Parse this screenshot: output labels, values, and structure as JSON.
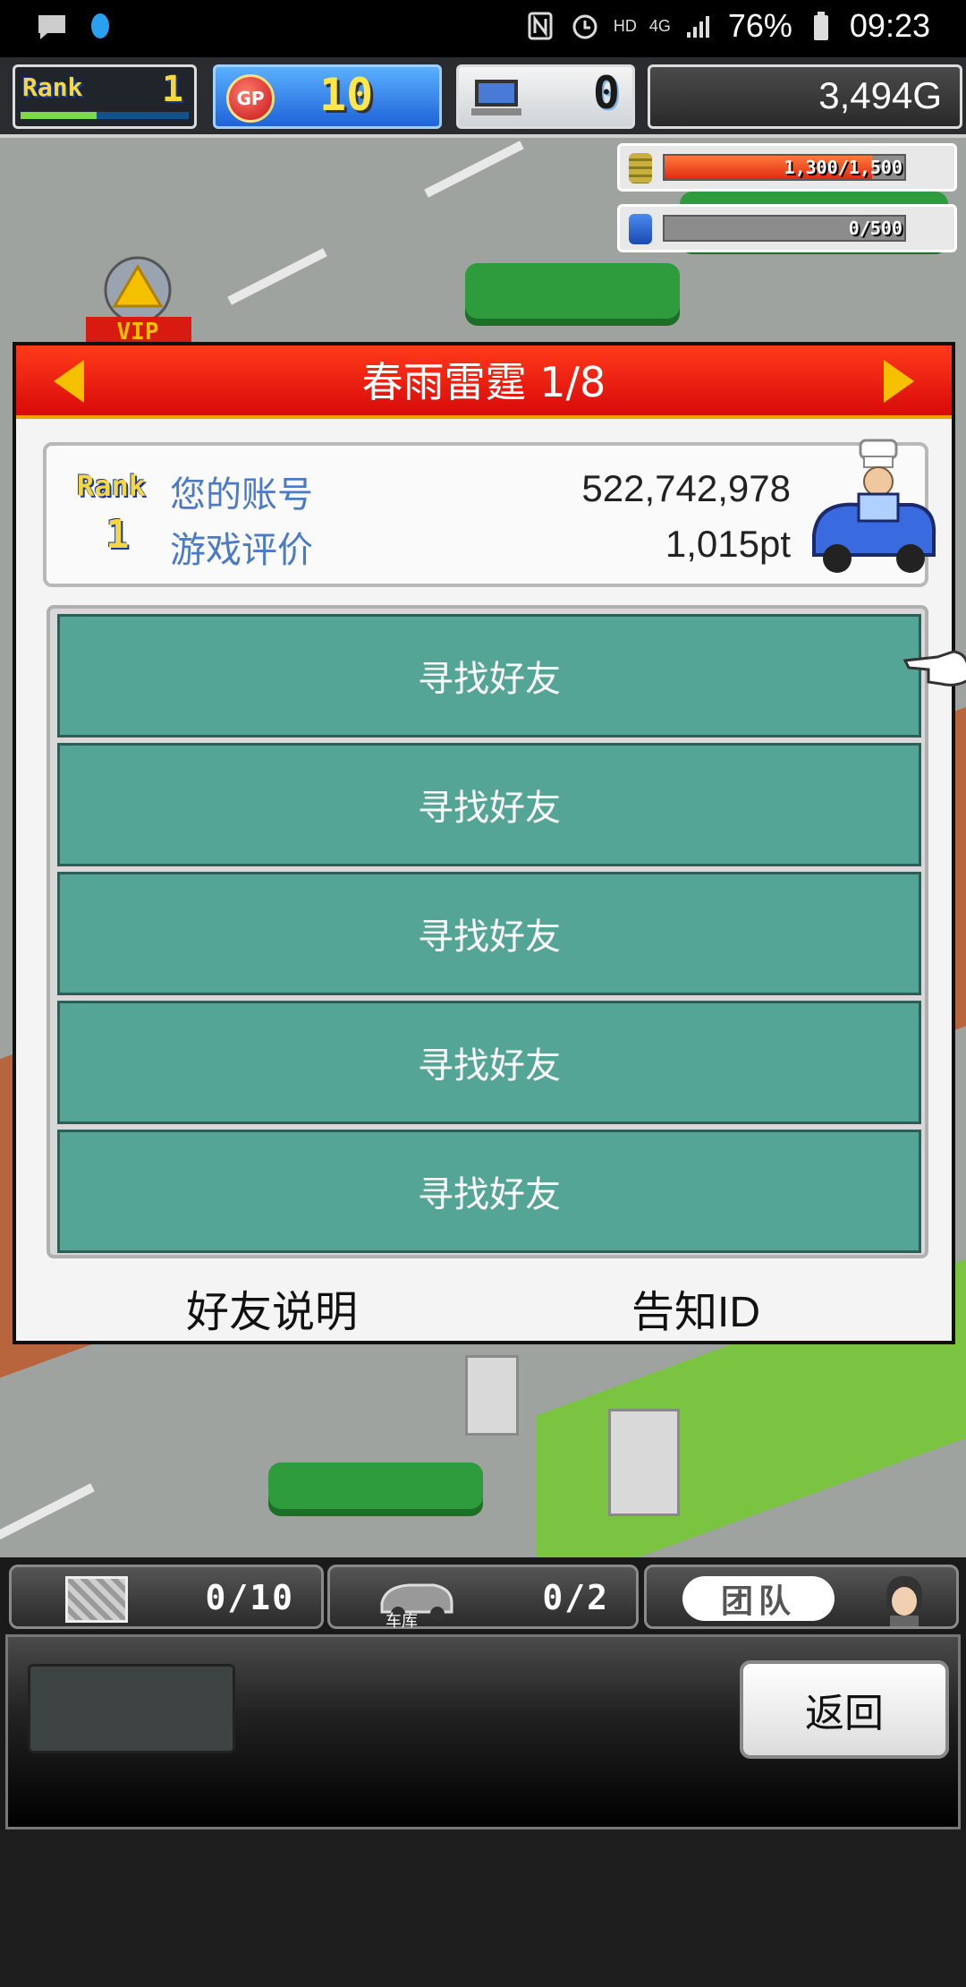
{
  "status_bar": {
    "network": "4G",
    "hd": "HD",
    "battery": "76%",
    "time": "09:23"
  },
  "hud": {
    "rank_word": "Rank",
    "rank_value": "1",
    "rank_progress": 0.45,
    "gp_label": "GP",
    "gp_value": "10",
    "pc_value": "0",
    "money": "3,494G"
  },
  "world": {
    "fuel_text": "1,300/1,500",
    "fuel_fraction": 0.867,
    "research_text": "0/500",
    "research_fraction": 0.0,
    "vip_text": "VIP"
  },
  "modal": {
    "title": "春雨雷霆 1/8",
    "profile": {
      "rank_word": "Rank",
      "rank_value": "1",
      "account_label": "您的账号",
      "account_value": "522,742,978",
      "rating_label": "游戏评价",
      "rating_value": "1,015pt"
    },
    "friend_slots": [
      "寻找好友",
      "寻找好友",
      "寻找好友",
      "寻找好友",
      "寻找好友"
    ],
    "link_explain": "好友说明",
    "link_notify": "告知ID"
  },
  "bottom": {
    "box_count": "0/10",
    "garage_label": "车库",
    "garage_count": "0/2",
    "team_label": "团队",
    "back_label": "返回"
  },
  "colors": {
    "header_red": "#e81a10",
    "slot_teal": "#55a596",
    "label_blue": "#4a7ac8",
    "rank_gold": "#f5d840"
  }
}
